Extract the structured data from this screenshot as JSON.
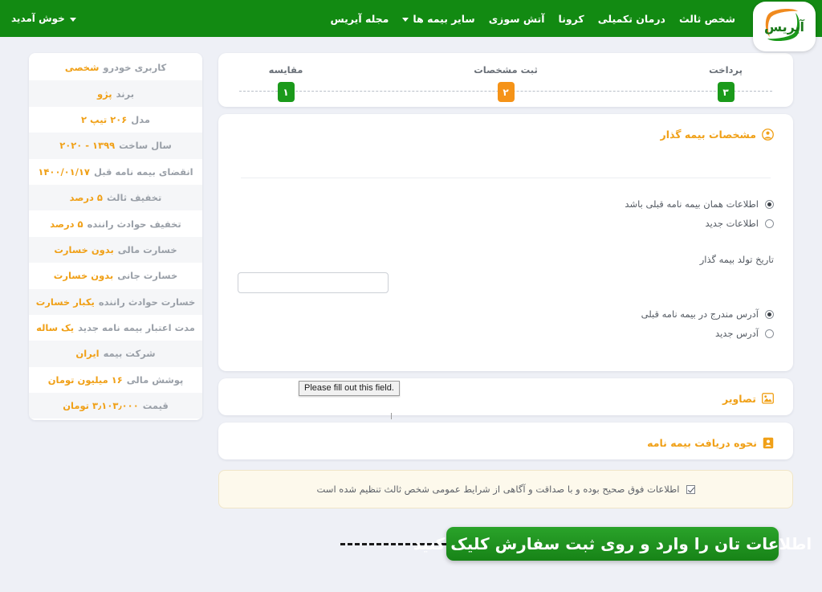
{
  "colors": {
    "nav_green": "#128a12",
    "accent_orange": "#f0a017",
    "step_active": "#f59318",
    "step_done": "#1b9a1b",
    "banner_green": "#2aa32a",
    "page_bg": "#eef0f6"
  },
  "navbar": {
    "logo_text": "آیریس",
    "links": [
      {
        "label": "شخص ثالث",
        "has_chevron": false
      },
      {
        "label": "درمان تکمیلی",
        "has_chevron": false
      },
      {
        "label": "کرونا",
        "has_chevron": false
      },
      {
        "label": "آتش سوزی",
        "has_chevron": false
      },
      {
        "label": "سایر بیمه ها",
        "has_chevron": true
      },
      {
        "label": "مجله آیریس",
        "has_chevron": false
      }
    ],
    "welcome": "خوش آمدید"
  },
  "stepper": {
    "steps": [
      {
        "label": "پرداخت",
        "number": "۳",
        "state": "done"
      },
      {
        "label": "ثبت مشخصات",
        "number": "۲",
        "state": "active"
      },
      {
        "label": "مقایسه",
        "number": "۱",
        "state": "done"
      }
    ]
  },
  "insurer_section": {
    "title": "مشخصات بیمه گذار",
    "icon": "user-circle-icon",
    "info_radios": [
      {
        "label": "اطلاعات همان بیمه نامه قبلی باشد",
        "selected": true
      },
      {
        "label": "اطلاعات جدید",
        "selected": false
      }
    ],
    "birthdate": {
      "label": "تاریخ تولد بیمه گذار",
      "value": "",
      "placeholder": ""
    },
    "validation_tooltip": "Please fill out this field.",
    "address_radios": [
      {
        "label": "آدرس مندرج در بیمه نامه قبلی",
        "selected": true
      },
      {
        "label": "آدرس جدید",
        "selected": false
      }
    ]
  },
  "collapsed_sections": [
    {
      "title": "تصاویر",
      "icon": "image-icon"
    },
    {
      "title": "نحوه دریافت بیمه نامه",
      "icon": "contact-card-icon"
    }
  ],
  "agreement": {
    "text": "اطلاعات فوق صحیح بوده و با صداقت و آگاهی از شرایط عمومی شخص ثالث تنظیم شده است",
    "checked": true
  },
  "submit": {
    "label": "ثبت سفارش"
  },
  "annotation": {
    "text": "اطلاعات تان را وارد و روی ثبت سفارش کلیک کنید"
  },
  "sidebar": {
    "rows": [
      {
        "label": "کاربری خودرو",
        "value": "شخصی"
      },
      {
        "label": "برند",
        "value": "پژو"
      },
      {
        "label": "مدل",
        "value": "۲۰۶ تیپ ۲"
      },
      {
        "label": "سال ساخت",
        "value": "۱۳۹۹ - ۲۰۲۰"
      },
      {
        "label": "انقضای بیمه نامه قبل",
        "value": "۱۴۰۰/۰۱/۱۷"
      },
      {
        "label": "تخفیف ثالث",
        "value": "۵ درصد"
      },
      {
        "label": "تخفیف حوادث راننده",
        "value": "۵ درصد"
      },
      {
        "label": "خسارت مالی",
        "value": "بدون خسارت"
      },
      {
        "label": "خسارت جانی",
        "value": "بدون خسارت"
      },
      {
        "label": "خسارت حوادث راننده",
        "value": "یکبار خسارت"
      },
      {
        "label": "مدت اعتبار بیمه نامه جدید",
        "value": "یک ساله"
      },
      {
        "label": "شرکت بیمه",
        "value": "ایران"
      },
      {
        "label": "پوشش مالی",
        "value": "۱۶ میلیون تومان"
      },
      {
        "label": "قیمت",
        "value": "۳٫۱۰۳٫۰۰۰ تومان"
      }
    ]
  }
}
